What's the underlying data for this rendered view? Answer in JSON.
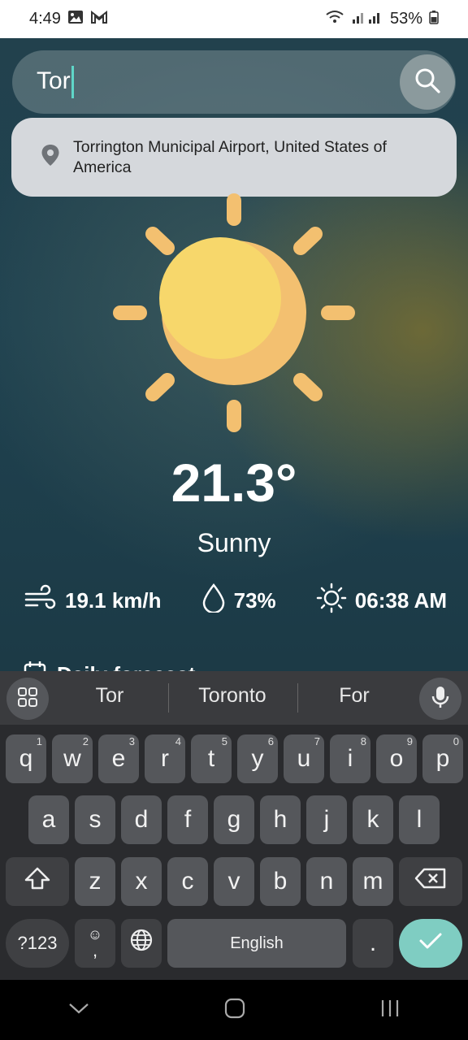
{
  "status_bar": {
    "time": "4:49",
    "battery": "53%"
  },
  "search": {
    "query": "Tor",
    "suggestion": "Torrington Municipal Airport, United States of America"
  },
  "weather": {
    "temperature": "21.3°",
    "condition": "Sunny",
    "wind": "19.1 km/h",
    "humidity": "73%",
    "sunrise": "06:38 AM",
    "daily_label": "Daily forecast"
  },
  "keyboard": {
    "suggestions": [
      "Tor",
      "Toronto",
      "For"
    ],
    "row1": [
      "q",
      "w",
      "e",
      "r",
      "t",
      "y",
      "u",
      "i",
      "o",
      "p"
    ],
    "row1_numbers": [
      "1",
      "2",
      "3",
      "4",
      "5",
      "6",
      "7",
      "8",
      "9",
      "0"
    ],
    "row2": [
      "a",
      "s",
      "d",
      "f",
      "g",
      "h",
      "j",
      "k",
      "l"
    ],
    "row3": [
      "z",
      "x",
      "c",
      "v",
      "b",
      "n",
      "m"
    ],
    "symbols_label": "?123",
    "comma_label": ",",
    "space_label": "English",
    "period_label": "."
  },
  "colors": {
    "accent": "#5fd6c8",
    "sun_yellow": "#f7d76b",
    "sun_orange": "#f3c070",
    "enter_key": "#7fcdc2"
  },
  "icons": {
    "search": "search-icon",
    "location": "location-pin-icon",
    "wind": "wind-icon",
    "humidity": "droplet-icon",
    "sunrise": "sun-icon",
    "mic": "microphone-icon"
  }
}
